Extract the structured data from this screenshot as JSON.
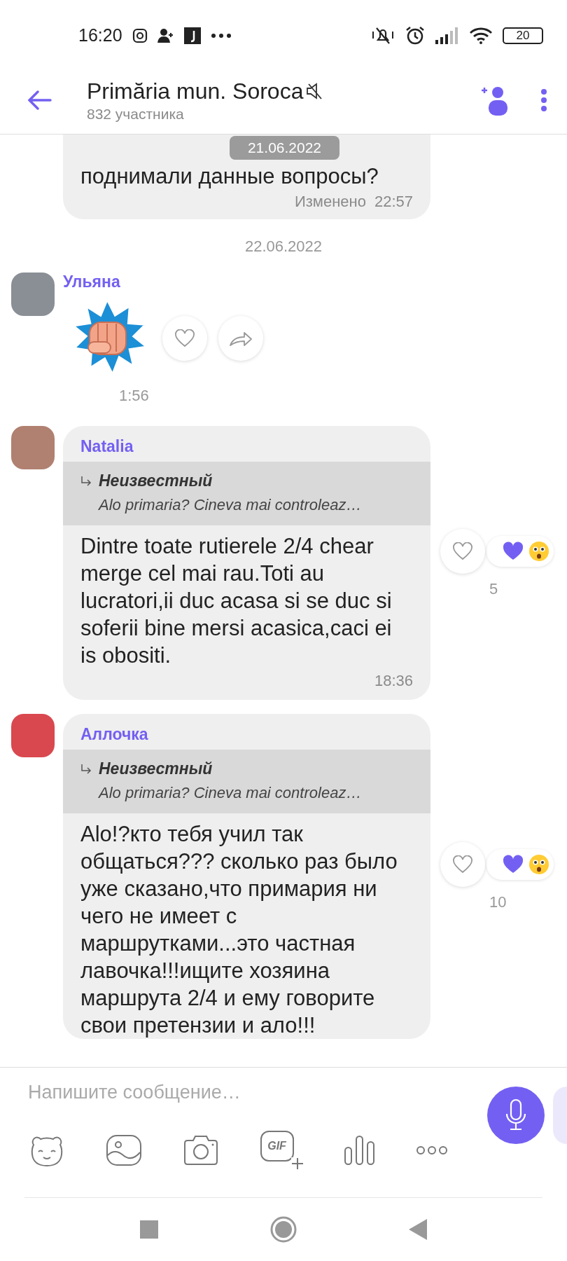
{
  "status_bar": {
    "time": "16:20",
    "battery": "20"
  },
  "header": {
    "title": "Primăria mun. Soroca",
    "subtitle": "832 участника",
    "muted": true
  },
  "floating_date": "21.06.2022",
  "messages": [
    {
      "kind": "tail",
      "text": "поднимали данные вопросы?",
      "edited_label": "Изменено",
      "time": "22:57"
    },
    {
      "kind": "date",
      "text": "22.06.2022"
    },
    {
      "kind": "sticker",
      "sender": "Ульяна",
      "time": "1:56"
    },
    {
      "kind": "reply",
      "sender": "Natalia",
      "quote_author": "Неизвестный",
      "quote_text": "Alo primaria? Cineva mai  controleaz…",
      "text": "Dintre toate rutierele 2/4 chear merge cel mai rau.Toti au lucratori,ii duc acasa si se duc si soferii bine mersi acasica,caci ei is obositi.",
      "time": "18:36",
      "reaction_count": "5"
    },
    {
      "kind": "reply",
      "sender": "Аллочка",
      "quote_author": "Неизвестный",
      "quote_text": "Alo primaria? Cineva mai  controleaz…",
      "text": "Alo!?кто тебя учил так общаться??? сколько раз было уже сказано,что примария ни чего не имеет с маршрутками...это частная лавочка!!!ищите хозяина маршрута 2/4 и ему говорите свои претензии и ало!!!",
      "reaction_count": "10"
    }
  ],
  "composer": {
    "placeholder": "Напишите сообщение…",
    "gif_label": "GIF"
  }
}
